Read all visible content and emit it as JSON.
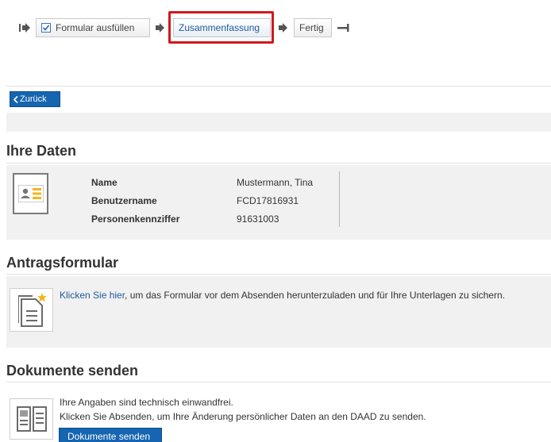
{
  "wizard": {
    "steps": [
      {
        "label": "Formular ausfüllen",
        "checked": true
      },
      {
        "label": "Zusammenfassung",
        "active": true
      },
      {
        "label": "Fertig"
      }
    ]
  },
  "nav": {
    "back_label": "Zurück",
    "back_icon": "chevron-left-icon"
  },
  "ihre_daten": {
    "title": "Ihre Daten",
    "rows": [
      {
        "label": "Name",
        "value": "Mustermann, Tina"
      },
      {
        "label": "Benutzername",
        "value": "FCD17816931"
      },
      {
        "label": "Personenkennziffer",
        "value": "91631003"
      }
    ]
  },
  "antragsformular": {
    "title": "Antragsformular",
    "link_text": "Klicken Sie hier",
    "text": ", um das Formular vor dem Absenden herunterzuladen und für Ihre Unterlagen zu sichern."
  },
  "dokumente": {
    "title": "Dokumente senden",
    "line1": "Ihre Angaben sind technisch einwandfrei.",
    "line2": "Klicken Sie Absenden, um Ihre Änderung persönlicher Daten an den DAAD zu senden.",
    "button_label": "Dokumente senden"
  },
  "colors": {
    "accent": "#1565b0",
    "highlight": "#d0191e",
    "panel": "#f1f1f1"
  }
}
